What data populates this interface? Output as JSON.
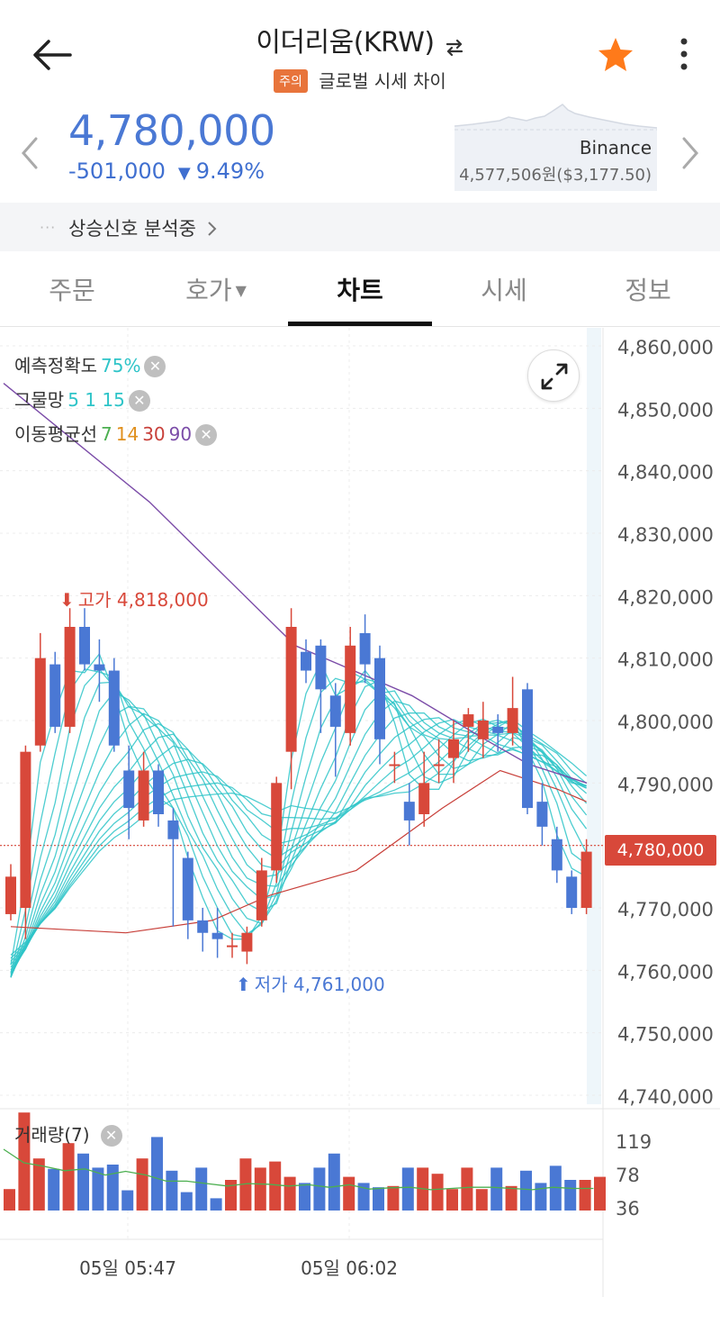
{
  "header": {
    "title": "이더리움(KRW)",
    "caution_badge": "주의",
    "subtitle": "글로벌 시세 차이"
  },
  "price": {
    "current": "4,780,000",
    "change_amount": "-501,000",
    "change_symbol": "▼",
    "change_percent": "9.49%",
    "exchange_name": "Binance",
    "exchange_price": "4,577,506원($3,177.50)"
  },
  "signal": {
    "dots": "···",
    "text": "상승신호 분석중"
  },
  "tabs": [
    {
      "label": "주문"
    },
    {
      "label": "호가"
    },
    {
      "label": "차트"
    },
    {
      "label": "시세"
    },
    {
      "label": "정보"
    }
  ],
  "indicators": {
    "accuracy": {
      "label": "예측정확도",
      "value": "75%"
    },
    "net": {
      "label": "그물망",
      "values": "5 1 15"
    },
    "ma": {
      "label": "이동평균선",
      "p1": "7",
      "p2": "14",
      "p3": "30",
      "p4": "90"
    },
    "volume": {
      "label": "거래량(7)"
    }
  },
  "annotations": {
    "high": "고가 4,818,000",
    "low": "저가 4,761,000",
    "current_badge": "4,780,000"
  },
  "colors": {
    "up": "#d8483a",
    "down": "#4a78d4",
    "net": "#2ec4c8",
    "ma7": "#4caf50",
    "ma14": "#e0901e",
    "ma30": "#c8403a",
    "ma90": "#7b4ca8",
    "accent": "#4a78d4"
  },
  "chart_data": {
    "type": "candlestick",
    "y_ticks": [
      "4,860,000",
      "4,850,000",
      "4,840,000",
      "4,830,000",
      "4,820,000",
      "4,810,000",
      "4,800,000",
      "4,790,000",
      "4,780,000",
      "4,770,000",
      "4,760,000",
      "4,750,000",
      "4,740,000"
    ],
    "ylim": [
      4740000,
      4860000
    ],
    "x_tick_labels": [
      "05일 05:47",
      "05일 06:02"
    ],
    "candles": [
      [
        4769,
        4775,
        4768,
        4777
      ],
      [
        4770,
        4795,
        4765,
        4796
      ],
      [
        4796,
        4810,
        4795,
        4814
      ],
      [
        4809,
        4799,
        4798,
        4811
      ],
      [
        4799,
        4815,
        4798,
        4818
      ],
      [
        4815,
        4809,
        4808,
        4818
      ],
      [
        4809,
        4808,
        4803,
        4813
      ],
      [
        4808,
        4796,
        4795,
        4810
      ],
      [
        4792,
        4786,
        4781,
        4796
      ],
      [
        4784,
        4792,
        4783,
        4795
      ],
      [
        4792,
        4785,
        4783,
        4793
      ],
      [
        4784,
        4781,
        4767,
        4786
      ],
      [
        4778,
        4768,
        4765,
        4779
      ],
      [
        4768,
        4766,
        4763,
        4770
      ],
      [
        4766,
        4765,
        4762,
        4770
      ],
      [
        4764,
        4764,
        4762,
        4766
      ],
      [
        4763,
        4766,
        4761,
        4767
      ],
      [
        4768,
        4776,
        4767,
        4778
      ],
      [
        4776,
        4790,
        4774,
        4791
      ],
      [
        4795,
        4815,
        4789,
        4818
      ],
      [
        4811,
        4808,
        4806,
        4813
      ],
      [
        4812,
        4805,
        4798,
        4813
      ],
      [
        4804,
        4799,
        4791,
        4806
      ],
      [
        4798,
        4812,
        4796,
        4815
      ],
      [
        4814,
        4809,
        4806,
        4817
      ],
      [
        4810,
        4797,
        4793,
        4812
      ],
      [
        4793,
        4793,
        4790,
        4795
      ],
      [
        4787,
        4784,
        4780,
        4790
      ],
      [
        4785,
        4790,
        4783,
        4795
      ],
      [
        4793,
        4793,
        4790,
        4797
      ],
      [
        4794,
        4797,
        4790,
        4800
      ],
      [
        4799,
        4801,
        4795,
        4802
      ],
      [
        4797,
        4800,
        4794,
        4803
      ],
      [
        4799,
        4798,
        4795,
        4801
      ],
      [
        4798,
        4802,
        4796,
        4807
      ],
      [
        4805,
        4786,
        4785,
        4806
      ],
      [
        4787,
        4783,
        4780,
        4790
      ],
      [
        4781,
        4776,
        4774,
        4783
      ],
      [
        4775,
        4770,
        4769,
        4776
      ],
      [
        4770,
        4779,
        4769,
        4781
      ]
    ],
    "ma90": [
      [
        0,
        4854
      ],
      [
        20,
        4835
      ],
      [
        40,
        4812
      ],
      [
        56,
        4804
      ],
      [
        66,
        4797
      ],
      [
        72,
        4793
      ],
      [
        80,
        4790
      ]
    ],
    "ma30": [
      [
        0,
        4767
      ],
      [
        8,
        4766
      ],
      [
        14,
        4768
      ],
      [
        18,
        4772
      ],
      [
        24,
        4776
      ],
      [
        30,
        4786
      ],
      [
        34,
        4792
      ],
      [
        38,
        4789
      ],
      [
        40,
        4787
      ]
    ],
    "volume": {
      "y_ticks": [
        "119",
        "78",
        "36"
      ],
      "values": [
        35,
        160,
        85,
        68,
        110,
        93,
        70,
        75,
        33,
        85,
        120,
        65,
        30,
        70,
        20,
        50,
        85,
        70,
        80,
        55,
        45,
        70,
        93,
        55,
        45,
        38,
        40,
        70,
        70,
        60,
        35,
        70,
        35,
        70,
        40,
        65,
        45,
        73,
        50,
        50,
        55
      ],
      "ma7": [
        100,
        78,
        72,
        65,
        68,
        58,
        64,
        58,
        48,
        48,
        44,
        40,
        44,
        43,
        40,
        42,
        38,
        42,
        35,
        37,
        38,
        34,
        36,
        38,
        38,
        36,
        34,
        38,
        36,
        36
      ]
    }
  }
}
